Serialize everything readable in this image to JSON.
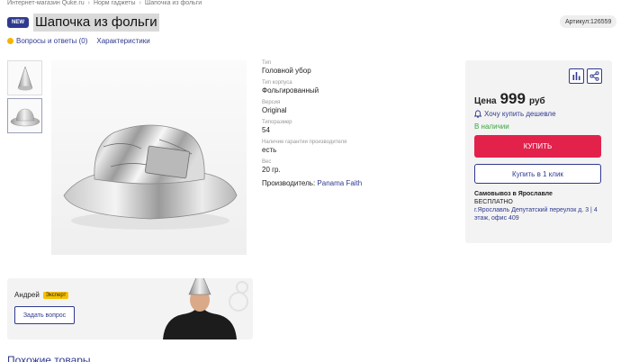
{
  "breadcrumbs": [
    "Интернет-магазин Quke.ru",
    "Норм гаджеты",
    "Шапочка из фольги"
  ],
  "breadcrumb_separator": "›",
  "badge": "NEW",
  "product": {
    "title": "Шапочка из фольги",
    "article": "Артикул:126559"
  },
  "tabs": {
    "qa": "Вопросы и ответы (0)",
    "specs": "Характеристики"
  },
  "specs": [
    {
      "key": "Тип",
      "value": "Головной убор"
    },
    {
      "key": "Тип корпуса",
      "value": "Фольгированный"
    },
    {
      "key": "Версия",
      "value": "Original"
    },
    {
      "key": "Типоразмер",
      "value": "54"
    },
    {
      "key": "Наличие гарантии производителя",
      "value": "есть"
    },
    {
      "key": "Вес",
      "value": "20 гр."
    }
  ],
  "producer": {
    "label": "Производитель:",
    "value": "Panama Faith"
  },
  "buy_box": {
    "price_label": "Цена",
    "price": "999",
    "currency": "руб",
    "cheaper_link": "Хочу купить дешевле",
    "stock": "В наличии",
    "buy_button": "КУПИТЬ",
    "oneclick_button": "Купить в 1 клик",
    "pickup_title": "Самовывоз в Ярославле",
    "pickup_free": "БЕСПЛАТНО",
    "pickup_address": "г.Ярославль Депутатский переулок д. 3 | 4 этаж, офис 409"
  },
  "expert": {
    "name": "Андрей",
    "tag": "Эксперт",
    "ask_button": "Задать вопрос"
  },
  "similar_heading": "Похожие товары",
  "colors": {
    "brand": "#2f3a8f",
    "buy": "#e3224c",
    "in_stock": "#3aa640",
    "tag": "#f5c000"
  },
  "icons": [
    "chat-icon",
    "compare-icon",
    "share-icon",
    "bell-icon"
  ]
}
